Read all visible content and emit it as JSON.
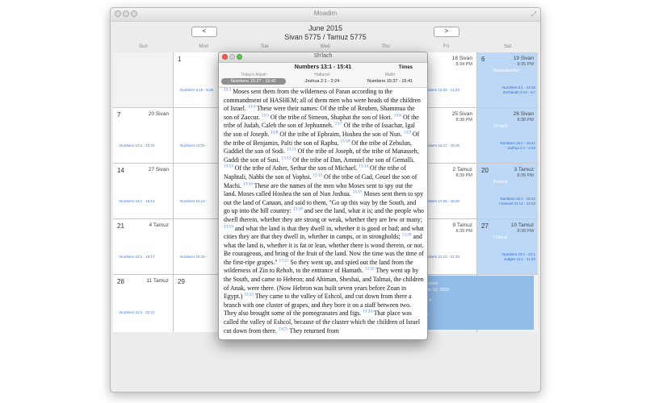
{
  "window": {
    "title": "Moadim"
  },
  "nav": {
    "month": "June 2015",
    "hebrew_months": "Sivan 5775 / Tamuz 5775",
    "prev_label": "<",
    "next_label": ">"
  },
  "days": [
    "Sun",
    "Mon",
    "Tue",
    "Wed",
    "Thu",
    "Fri",
    "Sat"
  ],
  "calendar": {
    "week1": {
      "mon": {
        "num": "1",
        "reading": "Numbers 8:15 - 8:26"
      },
      "fri": {
        "heb": "18 Sivan",
        "time": "8:34 PM",
        "reading": "Numbers 10:35 - 11:29"
      },
      "sat": {
        "num": "6",
        "heb": "19 Sivan",
        "time": "8:35 PM",
        "parsha": "Beha'alotcha",
        "line1": "Numbers 8:1 - 12:16",
        "line2": "Zechariah 2:14 - 4:7"
      }
    },
    "week2": {
      "sun": {
        "num": "7",
        "heb": "20 Sivan",
        "reading": "Numbers 13:1 - 13:20"
      },
      "mon": {
        "reading": "Numbers 13:21 -"
      },
      "fri": {
        "heb": "25 Sivan",
        "time": "8:38 PM",
        "reading": "Numbers 15:17 - 15:26"
      },
      "sat": {
        "heb": "26 Sivan",
        "time": "8:38 PM",
        "parsha": "Sh'lach",
        "line1": "Numbers 13:1 - 15:41",
        "line2": "Joshua 2:1 - 2:24"
      }
    },
    "week3": {
      "sun": {
        "num": "14",
        "heb": "27 Sivan",
        "reading": "Numbers 16:1 - 16:13"
      },
      "mon": {
        "reading": "Numbers 16:14 -"
      },
      "fri": {
        "heb": "2 Tamuz",
        "time": "8:39 PM",
        "reading": "Numbers 17:25 - 18:20"
      },
      "sat": {
        "num": "20",
        "heb": "3 Tamuz",
        "time": "8:39 PM",
        "parsha": "Korach",
        "line1": "Numbers 16:1 - 18:32",
        "line2": "I Samuel 11:14 - 12:22"
      }
    },
    "week4": {
      "sun": {
        "num": "21",
        "heb": "4 Tamuz",
        "reading": "Numbers 19:1 - 19:17"
      },
      "mon": {
        "reading": "Numbers 19:18 -"
      },
      "fri": {
        "heb": "9 Tamuz",
        "time": "8:39 PM",
        "reading": "Numbers 21:10 - 21:20"
      },
      "sat": {
        "num": "27",
        "heb": "10 Tamuz",
        "time": "8:39 PM",
        "parsha": "Chukat",
        "line1": "Numbers 19:1 - 22:1",
        "line2": "Judges 11:1 - 11:33"
      }
    },
    "week5": {
      "sun": {
        "num": "28",
        "heb": "11 Tamuz",
        "reading": "Numbers 22:2 - 22:12"
      },
      "mon": {
        "num": "29"
      }
    },
    "selection": {
      "line1": "cle year)",
      "line2": "mber 13, 2015",
      "line3": "2014",
      "line4": "014",
      "line5": "14"
    }
  },
  "popup": {
    "title": "Sh'lach",
    "main_heading": "Numbers 13:1 - 15:41",
    "times_label": "Times",
    "columns": [
      {
        "label": "Today's Aliyah",
        "value": "Numbers 15:27 - 15:41"
      },
      {
        "label": "Haftarah",
        "value": "Joshua 2:1 - 2:24"
      },
      {
        "label": "Maftir",
        "value": "Numbers 15:37 - 15:41"
      }
    ],
    "verses": [
      {
        "n": "13:3",
        "t": "Moses sent them from the wilderness of Paran according to the commandment of HASHEM; all of them men who were heads of the children of Israel."
      },
      {
        "n": "13:4",
        "t": "These were their names: Of the tribe of Reuben, Shammua the son of Zaccur."
      },
      {
        "n": "13:5",
        "t": "Of the tribe of Simeon, Shaphat the son of Hori."
      },
      {
        "n": "13:6",
        "t": "Of the tribe of Judah, Caleb the son of Jephunneh."
      },
      {
        "n": "13:7",
        "t": "Of the tribe of Issachar, Igal the son of Joseph."
      },
      {
        "n": "13:8",
        "t": "Of the tribe of Ephraim, Hoshea the son of Nun."
      },
      {
        "n": "13:9",
        "t": "Of the tribe of Benjamin, Palti the son of Raphu."
      },
      {
        "n": "13:10",
        "t": "Of the tribe of Zebulun, Gaddiel the son of Sodi."
      },
      {
        "n": "13:11",
        "t": "Of the tribe of Joseph, of the tribe of Manasseh, Gaddi the son of Susi."
      },
      {
        "n": "13:12",
        "t": "Of the tribe of Dan, Ammiel the son of Gemalli."
      },
      {
        "n": "13:13",
        "t": "Of the tribe of Asher, Sethur the son of Michael."
      },
      {
        "n": "13:14",
        "t": "Of the tribe of Naphtali, Nahbi the son of Vophsi."
      },
      {
        "n": "13:15",
        "t": "Of the tribe of Gad, Geuel the son of Machi."
      },
      {
        "n": "13:16",
        "t": "These are the names of the men who Moses sent to spy out the land. Moses called Hoshea the son of Nun Joshua."
      },
      {
        "n": "13:17",
        "t": "Moses sent them to spy out the land of Canaan, and said to them, \"Go up this way by the South, and go up into the hill country:"
      },
      {
        "n": "13:18",
        "t": "and see the land, what it is; and the people who dwell therein, whether they are strong or weak, whether they are few or many;"
      },
      {
        "n": "13:19",
        "t": "and what the land is that they dwell in, whether it is good or bad; and what cities they are that they dwell in, whether in camps, or in strongholds;"
      },
      {
        "n": "13:20",
        "t": "and what the land is, whether it is fat or lean, whether there is wood therein, or not. Be courageous, and bring of the fruit of the land. Now the time was the time of the first-ripe grapes.\""
      },
      {
        "n": "13:21",
        "t": "So they went up, and spied out the land from the wilderness of Zin to Rehob, to the entrance of Hamath."
      },
      {
        "n": "13:22",
        "t": "They went up by the South, and came to Hebron; and Ahiman, Sheshai, and Talmai, the children of Anak, were there. (Now Hebron was built seven years before Zoan in Egypt.)"
      },
      {
        "n": "13:23",
        "t": "They came to the valley of Eshcol, and cut down from there a branch with one cluster of grapes, and they bore it on a staff between two. They also brought some of the pomegranates and figs."
      },
      {
        "n": "13:24",
        "t": "That place was called the valley of Eshcol, because of the cluster which the children of Israel cut down from there."
      },
      {
        "n": "13:25",
        "t": "They returned from"
      }
    ]
  }
}
